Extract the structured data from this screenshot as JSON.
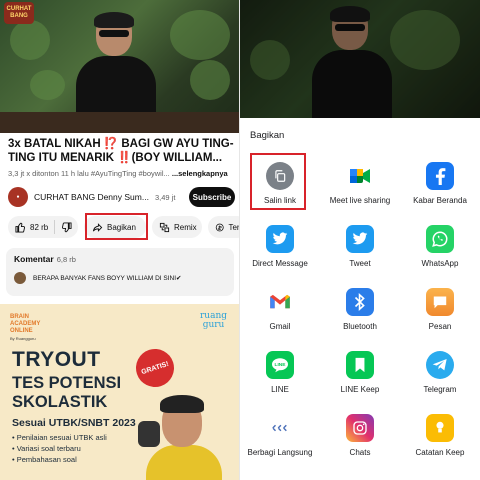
{
  "left": {
    "video_logo": "CURHAT BANG",
    "title": "3x BATAL NIKAH ⁉️ BAGI GW AYU TING-TING ITU MENARIK ‼️(BOY WILLIAM...",
    "meta": "3,3 jt x ditonton  11 h lalu  #AyuTingTing  #boywil...",
    "meta_more": "...selengkapnya",
    "channel": {
      "name": "CURHAT BANG Denny Sum...",
      "subs": "3,49 jt",
      "subscribe_label": "Subscribe"
    },
    "actions": {
      "likes": "82 rb",
      "share": "Bagikan",
      "remix": "Remix",
      "thanks": "Terim"
    },
    "comments": {
      "heading": "Komentar",
      "count": "6,8 rb",
      "top_comment": "BERAPA BANYAK FANS BOYY WILLIAM DI SINI✔"
    },
    "ad": {
      "brand_line1": "BRAIN",
      "brand_line2": "ACADEMY",
      "brand_line3": "ONLINE",
      "brand_by": "By Ruangguru",
      "partner_line1": "ruang",
      "partner_line2": "guru",
      "headline1": "TRYOUT",
      "headline2": "TES POTENSI",
      "headline3": "SKOLASTIK",
      "badge": "GRATIS!",
      "subheadline": "Sesuai UTBK/SNBT 2023",
      "bullets": [
        "Penilaian sesuai UTBK asli",
        "Variasi soal terbaru",
        "Pembahasan soal"
      ]
    }
  },
  "share_sheet": {
    "title": "Bagikan",
    "targets": [
      {
        "label": "Salin link",
        "icon": "copy-icon",
        "color": "#7b8188"
      },
      {
        "label": "Meet live sharing",
        "icon": "google-meet-icon",
        "color": "#ffffff"
      },
      {
        "label": "Kabar Beranda",
        "icon": "facebook-icon",
        "color": "#1877f2"
      },
      {
        "label": "Direct Message",
        "icon": "twitter-icon",
        "color": "#1d9bf0"
      },
      {
        "label": "Tweet",
        "icon": "twitter-icon",
        "color": "#1d9bf0"
      },
      {
        "label": "WhatsApp",
        "icon": "whatsapp-icon",
        "color": "#25d366"
      },
      {
        "label": "Gmail",
        "icon": "gmail-icon",
        "color": "#ffffff"
      },
      {
        "label": "Bluetooth",
        "icon": "bluetooth-icon",
        "color": "#2b7de9"
      },
      {
        "label": "Pesan",
        "icon": "message-icon",
        "color": "#f6a23c"
      },
      {
        "label": "LINE",
        "icon": "line-icon",
        "color": "#06c755"
      },
      {
        "label": "LINE Keep",
        "icon": "line-keep-icon",
        "color": "#06c755"
      },
      {
        "label": "Telegram",
        "icon": "telegram-icon",
        "color": "#2aabee"
      },
      {
        "label": "Berbagi Langsung",
        "icon": "direct-share-icon",
        "color": "#ffffff"
      },
      {
        "label": "Chats",
        "icon": "instagram-icon",
        "color": "#d6249f"
      },
      {
        "label": "Catatan Keep",
        "icon": "keep-icon",
        "color": "#fbbc04"
      }
    ]
  },
  "colors": {
    "highlight": "#d8232a",
    "subscribe_bg": "#0f0f0f"
  }
}
